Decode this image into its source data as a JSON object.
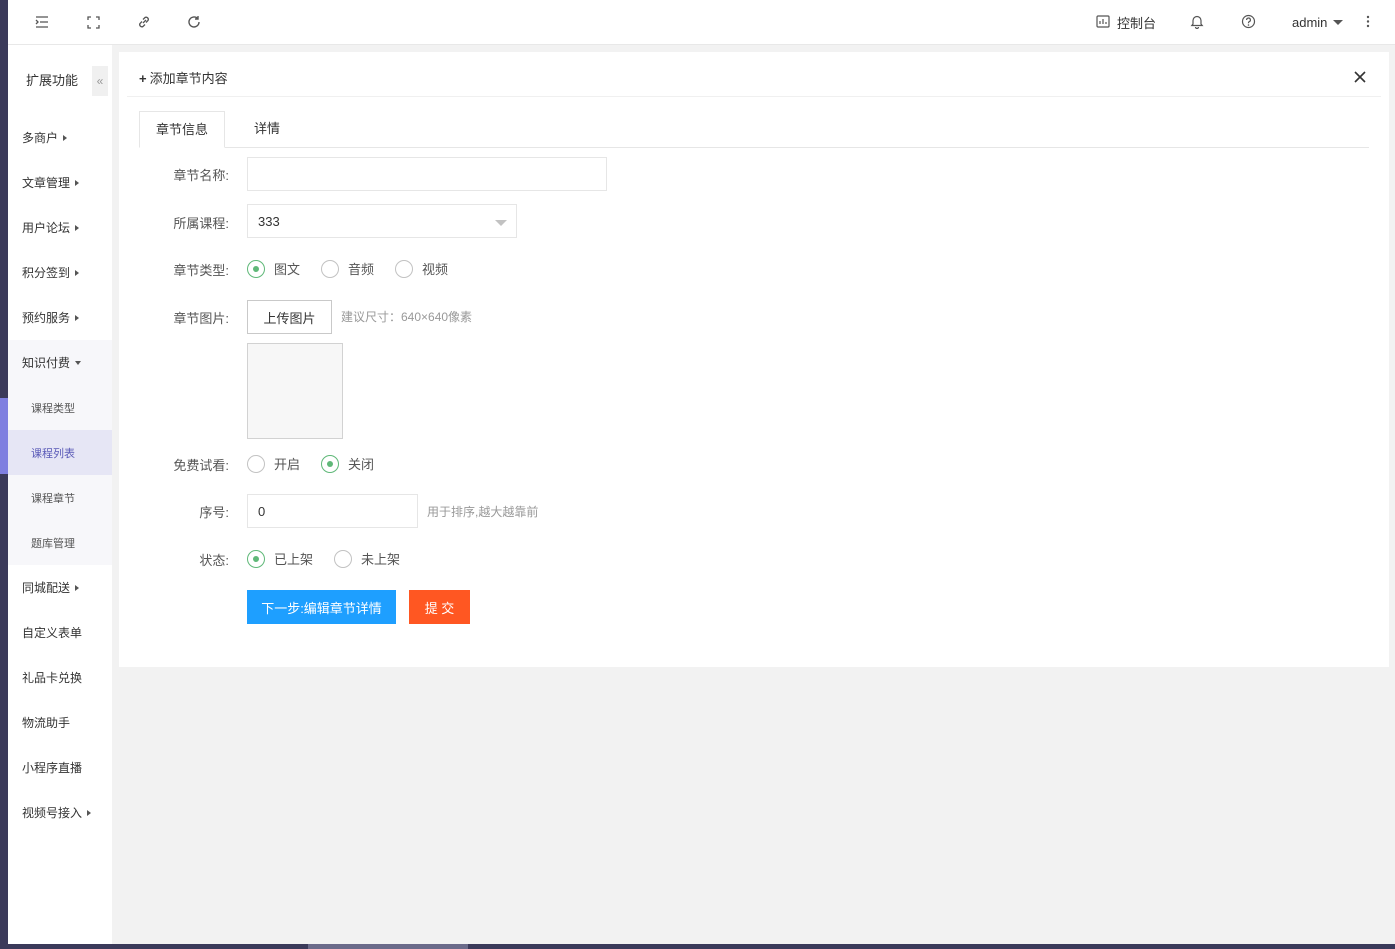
{
  "topbar": {
    "icons": [
      "menu-toggle-icon",
      "fullscreen-icon",
      "link-icon",
      "refresh-icon"
    ],
    "console_label": "控制台",
    "user_name": "admin"
  },
  "sidebar": {
    "title": "扩展功能",
    "collapse_glyph": "«",
    "items": [
      {
        "label": "多商户",
        "arrow": "right"
      },
      {
        "label": "文章管理",
        "arrow": "right"
      },
      {
        "label": "用户论坛",
        "arrow": "right"
      },
      {
        "label": "积分签到",
        "arrow": "right"
      },
      {
        "label": "预约服务",
        "arrow": "right"
      },
      {
        "label": "知识付费",
        "arrow": "down"
      }
    ],
    "sub_items": [
      {
        "label": "课程类型"
      },
      {
        "label": "课程列表"
      },
      {
        "label": "课程章节"
      },
      {
        "label": "题库管理"
      }
    ],
    "items_after": [
      {
        "label": "同城配送",
        "arrow": "right"
      },
      {
        "label": "自定义表单",
        "arrow": ""
      },
      {
        "label": "礼品卡兑换",
        "arrow": ""
      },
      {
        "label": "物流助手",
        "arrow": ""
      },
      {
        "label": "小程序直播",
        "arrow": ""
      },
      {
        "label": "视频号接入",
        "arrow": "right"
      }
    ]
  },
  "panel": {
    "title": "添加章节内容",
    "tabs": [
      {
        "label": "章节信息"
      },
      {
        "label": "详情"
      }
    ]
  },
  "form": {
    "name_label": "章节名称:",
    "name_value": "",
    "course_label": "所属课程:",
    "course_value": "333",
    "type_label": "章节类型:",
    "type_options": [
      "图文",
      "音频",
      "视频"
    ],
    "type_selected": "图文",
    "image_label": "章节图片:",
    "upload_label": "上传图片",
    "image_hint": "建议尺寸：640×640像素",
    "trial_label": "免费试看:",
    "trial_options": [
      "开启",
      "关闭"
    ],
    "trial_selected": "关闭",
    "order_label": "序号:",
    "order_value": "0",
    "order_hint": "用于排序,越大越靠前",
    "status_label": "状态:",
    "status_options": [
      "已上架",
      "未上架"
    ],
    "status_selected": "已上架",
    "next_button": "下一步:编辑章节详情",
    "submit_button": "提 交"
  },
  "colors": {
    "primary": "#1e9fff",
    "danger": "#ff5722",
    "radio_on": "#5fb878",
    "sidebar_active": "#5b5bb8"
  }
}
